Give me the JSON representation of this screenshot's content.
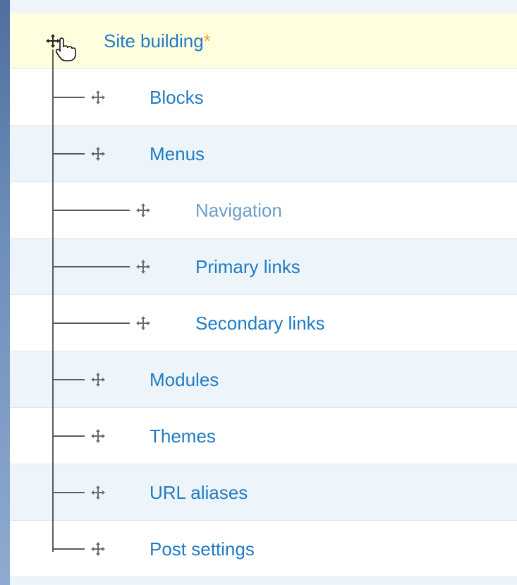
{
  "menu_tree": {
    "parent": {
      "label": "Site building",
      "changed_marker": "*"
    },
    "children": [
      {
        "label": "Blocks"
      },
      {
        "label": "Menus"
      },
      {
        "label": "Navigation"
      },
      {
        "label": "Primary links"
      },
      {
        "label": "Secondary links"
      },
      {
        "label": "Modules"
      },
      {
        "label": "Themes"
      },
      {
        "label": "URL aliases"
      },
      {
        "label": "Post settings"
      }
    ]
  },
  "colors": {
    "link": "#1f7bc1",
    "link_muted": "#6d9dc6",
    "changed_marker": "#f2a11f",
    "row_alt": "#edf5fa",
    "row_active": "#ffffe0"
  },
  "icons": {
    "drag_handle": "move-cross-arrows-icon",
    "cursor": "hand-pointer-cursor-icon"
  }
}
